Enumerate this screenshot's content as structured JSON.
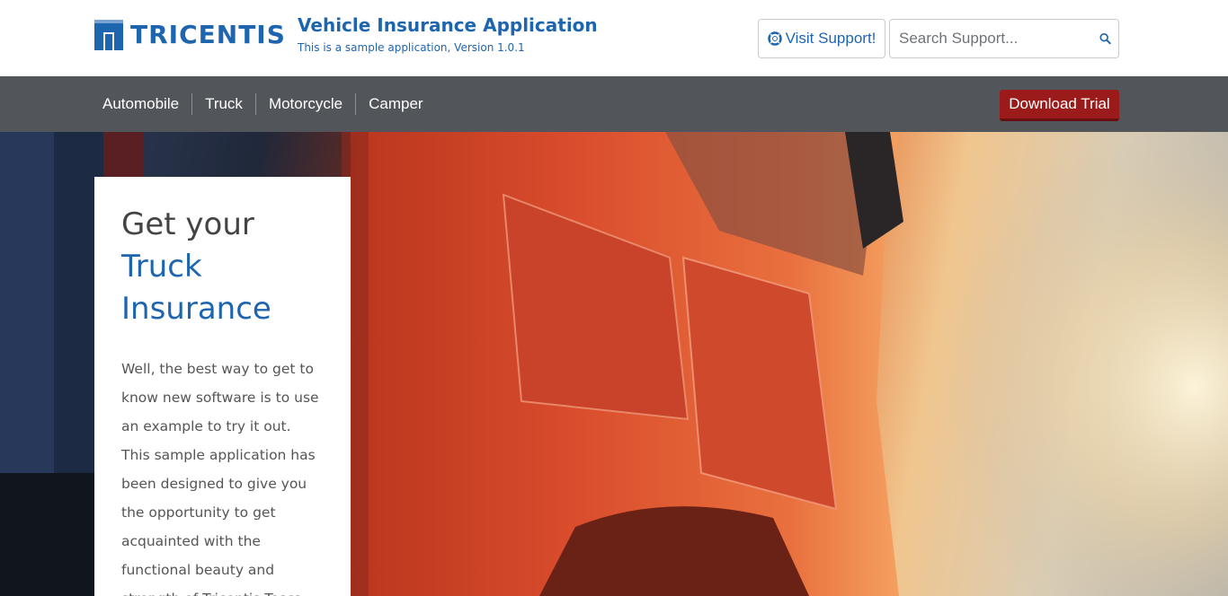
{
  "header": {
    "logo_text": "TRICENTIS",
    "app_title": "Vehicle Insurance Application",
    "app_subtitle": "This is a sample application, Version 1.0.1",
    "support_button_label": "Visit Support!",
    "search_placeholder": "Search Support..."
  },
  "nav": {
    "items": [
      {
        "label": "Automobile"
      },
      {
        "label": "Truck"
      },
      {
        "label": "Motorcycle"
      },
      {
        "label": "Camper"
      }
    ],
    "download_label": "Download Trial"
  },
  "hero": {
    "card": {
      "title_line1": "Get your",
      "title_highlight": "Truck Insurance",
      "body": "Well, the best way to get to know new software is to use an example to try it out. This sample application has been designed to give you the opportunity to get acquainted with the functional beauty and strength of Tricentis Tosca"
    }
  },
  "colors": {
    "brand_blue": "#1e65b0",
    "nav_bg": "#52565b",
    "download_red": "#9b1a1a"
  }
}
